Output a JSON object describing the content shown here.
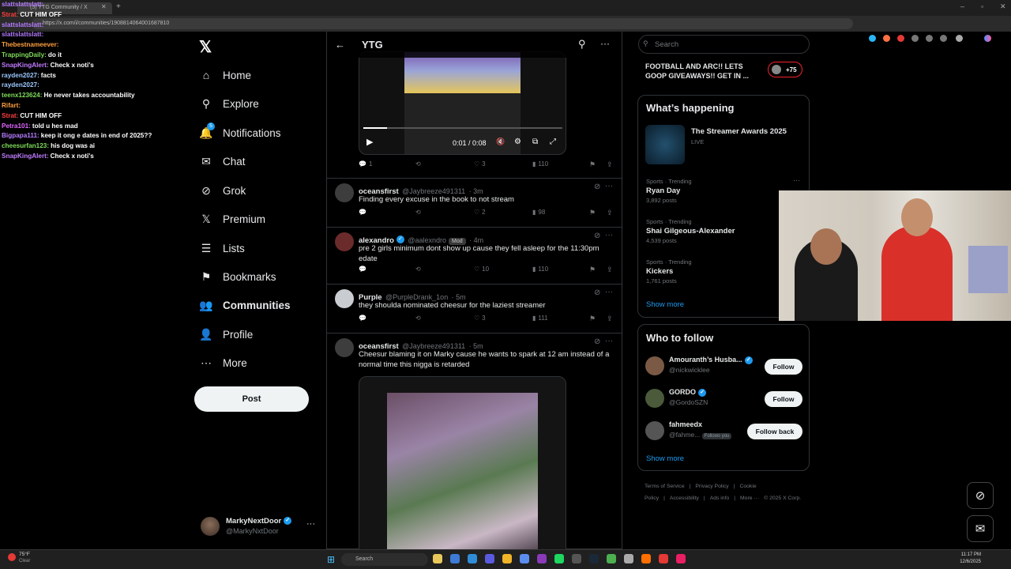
{
  "browser": {
    "tab_title": "(5) YTG Community / X",
    "url": "https://x.com/i/communities/1908814064001687810"
  },
  "chat": [
    {
      "user": "slattslattslatt:",
      "msg": "",
      "color": "#b57cff"
    },
    {
      "user": "Strat:",
      "msg": "CUT HIM OFF",
      "color": "#ff4040"
    },
    {
      "user": "slattslattslatt:",
      "msg": "",
      "color": "#b57cff"
    },
    {
      "user": "slattslattslatt:",
      "msg": "",
      "color": "#b57cff"
    },
    {
      "user": "Thebestnameever:",
      "msg": "",
      "color": "#ff9f40"
    },
    {
      "user": "TrappingDaily:",
      "msg": "do it",
      "color": "#7fdc5a"
    },
    {
      "user": "SnapKingAlert:",
      "msg": "Check x noti's",
      "color": "#c07cff"
    },
    {
      "user": "rayden2027:",
      "msg": "facts",
      "color": "#9cc8ff"
    },
    {
      "user": "rayden2027:",
      "msg": "",
      "color": "#9cc8ff"
    },
    {
      "user": "teenx123624:",
      "msg": "He never takes accountability",
      "color": "#7fdc5a"
    },
    {
      "user": "Rifart:",
      "msg": "",
      "color": "#ff9f40"
    },
    {
      "user": "Strat:",
      "msg": "CUT HIM OFF",
      "color": "#ff4040"
    },
    {
      "user": "Petra101:",
      "msg": "told u hes mad",
      "color": "#e066ff"
    },
    {
      "user": "Bigpapa111:",
      "msg": "keep it ong e dates in end of 2025??",
      "color": "#b57cff"
    },
    {
      "user": "cheesurfan123:",
      "msg": "his dog was ai",
      "color": "#7fdc5a"
    },
    {
      "user": "SnapKingAlert:",
      "msg": "Check x noti's",
      "color": "#c07cff"
    }
  ],
  "nav": {
    "items": [
      {
        "label": "Home",
        "icon": "home-icon",
        "glyph": "⌂"
      },
      {
        "label": "Explore",
        "icon": "search-icon",
        "glyph": "⚲"
      },
      {
        "label": "Notifications",
        "icon": "bell-icon",
        "glyph": "🔔"
      },
      {
        "label": "Chat",
        "icon": "mail-icon",
        "glyph": "✉"
      },
      {
        "label": "Grok",
        "icon": "grok-icon",
        "glyph": "⊘"
      },
      {
        "label": "Premium",
        "icon": "x-icon",
        "glyph": "𝕏"
      },
      {
        "label": "Lists",
        "icon": "list-icon",
        "glyph": "☰"
      },
      {
        "label": "Bookmarks",
        "icon": "bookmark-icon",
        "glyph": "⚑"
      },
      {
        "label": "Communities",
        "icon": "people-icon",
        "glyph": "👥"
      },
      {
        "label": "Profile",
        "icon": "person-icon",
        "glyph": "👤"
      },
      {
        "label": "More",
        "icon": "more-circle-icon",
        "glyph": "⋯"
      }
    ],
    "notification_count": "5",
    "post_label": "Post"
  },
  "account": {
    "name": "MarkyNextDoor",
    "handle": "@MarkyNxtDoor"
  },
  "community": {
    "title": "YTG"
  },
  "video1": {
    "time": "0:01 / 0:08",
    "progress": 0.12
  },
  "posts": [
    {
      "replies": "1",
      "reposts": "",
      "likes": "3",
      "views": "110"
    },
    {
      "name": "oceansfirst",
      "handle": "@Jaybreeze491311",
      "time": "· 3m",
      "text": "Finding every excuse in the book to not stream",
      "replies": "",
      "reposts": "",
      "likes": "2",
      "views": "98"
    },
    {
      "name": "alexandro",
      "handle": "@aalexndro",
      "badge": "Mod",
      "time": "· 4m",
      "text": "pre 2 girls minimum dont show up cause they fell asleep for the 11:30pm edate",
      "replies": "",
      "reposts": "",
      "likes": "10",
      "views": "110"
    },
    {
      "name": "Purple",
      "handle": "@PurpleDrank_1on",
      "time": "· 5m",
      "text": "they shoulda nominated cheesur for the laziest streamer",
      "replies": "",
      "reposts": "",
      "likes": "3",
      "views": "111"
    },
    {
      "name": "oceansfirst",
      "handle": "@Jaybreeze491311",
      "time": "· 5m",
      "text": "Cheesur blaming it on Marky cause he wants to spark at 12 am instead of a normal time this nigga is retarded"
    }
  ],
  "right": {
    "search_placeholder": "Search",
    "promo_text": "FOOTBALL AND ARC!! LETS GOOP GIVEAWAYS!! GET IN ...",
    "promo_count": "+75",
    "happening_title": "What’s happening",
    "event": {
      "name": "The Streamer Awards 2025",
      "status": "LIVE"
    },
    "trends": [
      {
        "meta": "Sports · Trending",
        "name": "Ryan Day",
        "posts": "3,892 posts"
      },
      {
        "meta": "Sports · Trending",
        "name": "Shai Gilgeous-Alexander",
        "posts": "4,539 posts"
      },
      {
        "meta": "Sports · Trending",
        "name": "Kickers",
        "posts": "1,761 posts"
      }
    ],
    "show_more": "Show more",
    "who_title": "Who to follow",
    "follow": [
      {
        "name": "Amouranth’s Husba...",
        "handle": "@nickwicklee",
        "button": "Follow",
        "follows_you": ""
      },
      {
        "name": "GORDO",
        "handle": "@GordoSZN",
        "button": "Follow",
        "follows_you": ""
      },
      {
        "name": "fahmeedx",
        "handle": "@fahme...",
        "button": "Follow back",
        "follows_you": "Follows you"
      }
    ],
    "footer": [
      "Terms of Service",
      "|",
      "Privacy Policy",
      "|",
      "Cookie Policy",
      "|",
      "Accessibility",
      "|",
      "Ads info",
      "|",
      "More ···",
      "© 2025 X Corp."
    ]
  },
  "taskbar": {
    "weather_temp": "75°F",
    "weather_desc": "Clear",
    "search": "Search",
    "time": "11:17 PM",
    "date": "12/6/2025"
  },
  "colors": {
    "accent": "#1d9bf0",
    "border": "#2f3336",
    "muted": "#71767b"
  }
}
